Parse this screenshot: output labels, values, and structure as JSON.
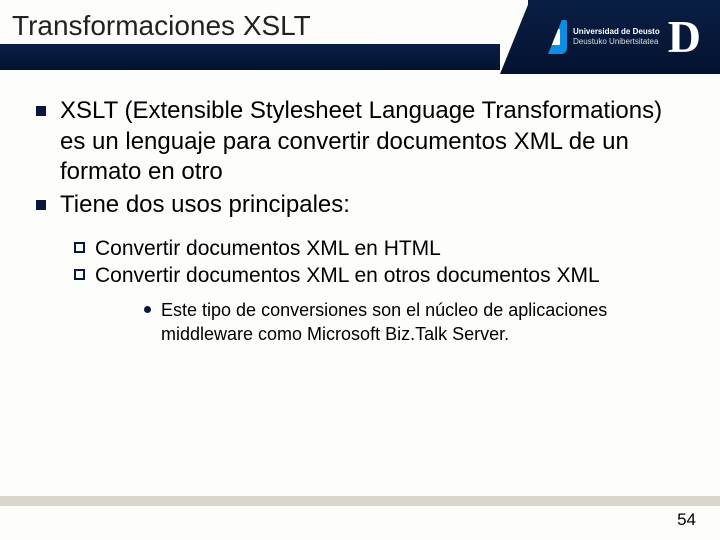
{
  "header": {
    "title": "Transformaciones XSLT",
    "logo": {
      "line1": "Universidad de Deusto",
      "line2": "Deustuko Unibertsitatea",
      "letter": "D"
    }
  },
  "bullets": [
    {
      "text": "XSLT (Extensible Stylesheet Language Transformations) es un lenguaje para convertir documentos XML de un formato en otro"
    },
    {
      "text": "Tiene dos usos principales:"
    }
  ],
  "subs": [
    {
      "text": "Convertir documentos XML en HTML"
    },
    {
      "text": "Convertir documentos XML en otros documentos XML"
    }
  ],
  "subsubs": [
    {
      "text": "Este tipo de conversiones son el núcleo de aplicaciones middleware como Microsoft Biz.Talk Server."
    }
  ],
  "page": "54"
}
